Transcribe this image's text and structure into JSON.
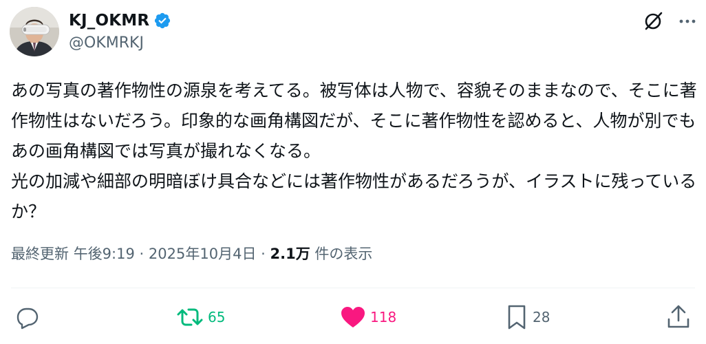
{
  "author": {
    "display_name": "KJ_OKMR",
    "handle": "@OKMRKJ",
    "verified": true
  },
  "post": {
    "text": "あの写真の著作物性の源泉を考えてる。被写体は人物で、容貌そのままなので、そこに著作物性はないだろう。印象的な画角構図だが、そこに著作物性を認めると、人物が別でもあの画角構図では写真が撮れなくなる。\n光の加減や細部の明暗ぼけ具合などには著作物性があるだろうが、イラストに残っているか？"
  },
  "meta": {
    "updated_label": "最終更新",
    "time": "午後9:19",
    "date": "2025年10月4日",
    "separator": "·",
    "views_count": "2.1万",
    "views_label": "件の表示"
  },
  "actions": {
    "replies": "",
    "reposts": "65",
    "likes": "118",
    "bookmarks": "28"
  },
  "colors": {
    "text_primary": "#0f1419",
    "text_secondary": "#536471",
    "verified_blue": "#1d9bf0",
    "repost_green": "#00ba7c",
    "like_pink": "#f91880",
    "divider": "#eff3f4"
  },
  "icons": {
    "avatar": "profile-photo-vr-headset",
    "verified": "verified-badge-icon",
    "grok": "grok-icon",
    "more": "more-dots-icon",
    "reply": "reply-bubble-icon",
    "repost": "repost-arrows-icon",
    "like": "heart-filled-icon",
    "bookmark": "bookmark-icon",
    "share": "share-upload-icon"
  }
}
